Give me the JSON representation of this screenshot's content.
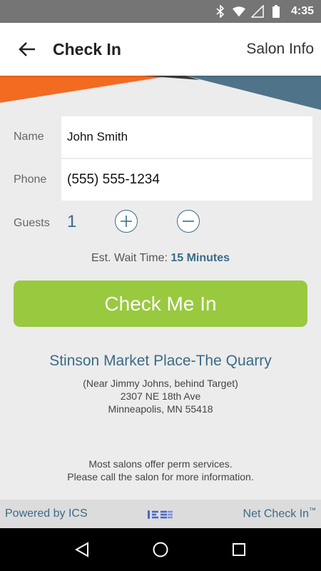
{
  "status_bar": {
    "time": "4:35",
    "icons": [
      "bluetooth-icon",
      "wifi-icon",
      "signal-icon",
      "battery-icon"
    ]
  },
  "app_bar": {
    "back_icon": "arrow-left-icon",
    "title": "Check In",
    "salon_info_label": "Salon Info"
  },
  "form": {
    "name_label": "Name",
    "name_value": "John Smith",
    "phone_label": "Phone",
    "phone_value": "(555) 555-1234",
    "guests_label": "Guests",
    "guests_count": "1",
    "wait_label": "Est. Wait Time: ",
    "wait_value": "15 Minutes"
  },
  "check_in_button": "Check Me In",
  "salon": {
    "name": "Stinson Market Place-The Quarry",
    "address_line_1": "(Near Jimmy Johns, behind Target)",
    "address_line_2": "2307 NE 18th Ave",
    "address_line_3": "Minneapolis, MN 55418"
  },
  "note": {
    "line_1": "Most salons offer perm services.",
    "line_2": "Please call the salon for more information."
  },
  "footer": {
    "powered_by": "Powered by ICS",
    "logo_text": "ICS",
    "net_check_in": "Net Check In",
    "trademark": "™"
  },
  "colors": {
    "accent_blue": "#3a6b86",
    "button_green": "#99c93f",
    "banner_orange": "#f26b21",
    "banner_slate": "#4f7389"
  }
}
